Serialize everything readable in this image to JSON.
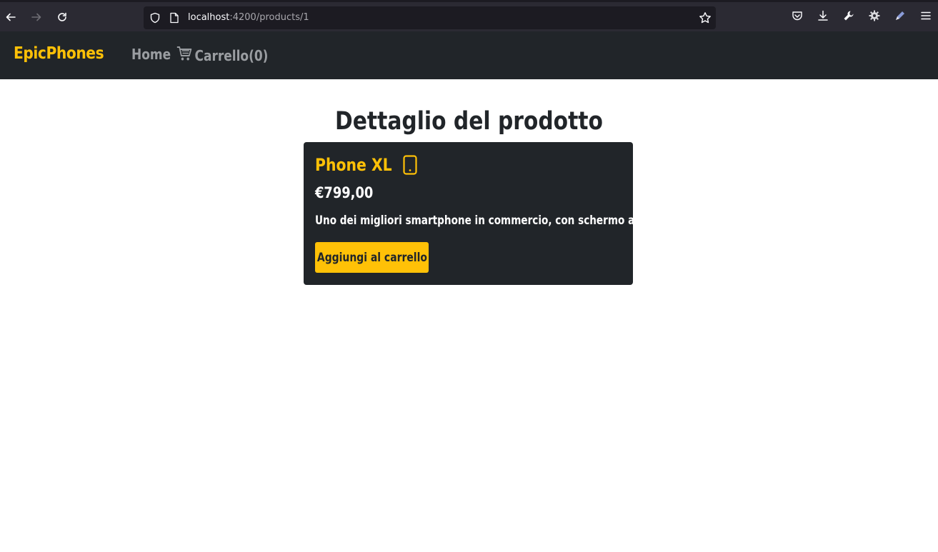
{
  "browser": {
    "url_host": "localhost",
    "url_path": ":4200/products/1",
    "icons": [
      "back-icon",
      "forward-icon",
      "reload-icon",
      "shield-icon",
      "page-icon",
      "bookmark-star-icon",
      "pocket-icon",
      "download-icon",
      "wrench-icon",
      "extension-gear-icon",
      "pen-icon",
      "menu-icon"
    ]
  },
  "navbar": {
    "brand": "EpicPhones",
    "home_label": "Home",
    "cart_label": "Carrello(0)",
    "cart_icon": "cart-icon"
  },
  "main": {
    "title": "Dettaglio del prodotto"
  },
  "product": {
    "name": "Phone XL",
    "icon": "phone-icon",
    "price": "€799,00",
    "description": "Uno dei migliori smartphone in commercio, con schermo ampio",
    "add_button_label": "Aggiungi al carrello"
  },
  "colors": {
    "accent": "#ffc107",
    "navbar_bg": "#212529",
    "chrome_bg": "#2b2a33"
  }
}
